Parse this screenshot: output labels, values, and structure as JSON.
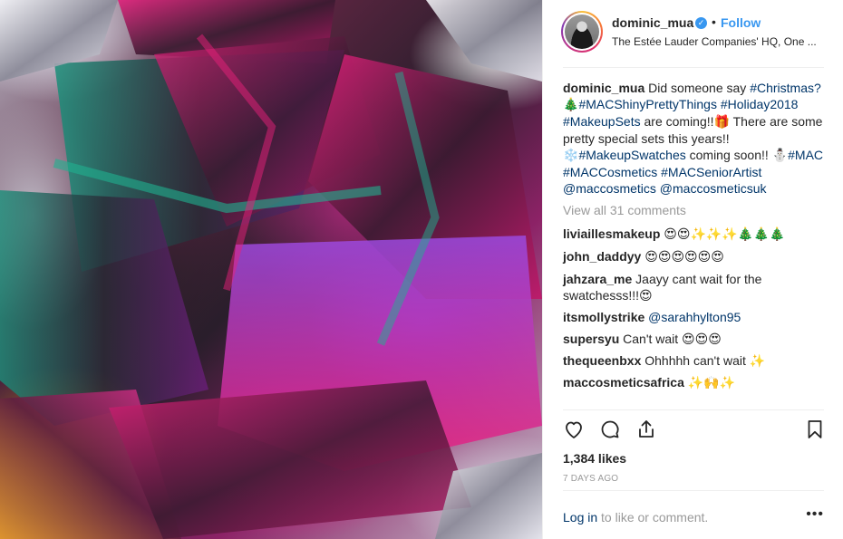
{
  "post": {
    "username": "dominic_mua",
    "verified_icon": "verified-badge-icon",
    "separator": "•",
    "follow_label": "Follow",
    "location": "The Estée Lauder Companies' HQ, One ..."
  },
  "caption": {
    "username": "dominic_mua",
    "text1": "Did someone say",
    "tag1": "#Christmas?",
    "emoji1": "🎄",
    "tag2": "#MACShinyPrettyThings",
    "tag3": "#Holiday2018",
    "tag4": "#MakeupSets",
    "text2": "are coming!!",
    "emoji2": "🎁",
    "text3": "There are some pretty special sets this years!!",
    "emoji3": "❄️",
    "tag5": "#MakeupSwatches",
    "text4": "coming soon!!",
    "emoji4": "⛄",
    "tag6": "#MAC",
    "tag7": "#MACCosmetics",
    "tag8": "#MACSeniorArtist",
    "tag9": "@maccosmetics",
    "tag10": "@maccosmeticsuk"
  },
  "view_all": "View all 31 comments",
  "comments": [
    {
      "user": "liviaillesmakeup",
      "text": "😍😍✨✨✨🎄🎄🎄"
    },
    {
      "user": "john_daddyy",
      "text": "😍😍😍😍😍😍"
    },
    {
      "user": "jahzara_me",
      "text": "Jaayy cant wait for the swatchesss!!!😍"
    },
    {
      "user": "itsmollystrike",
      "mention": "@sarahhylton95"
    },
    {
      "user": "supersyu",
      "text": "Can't wait 😍😍😍"
    },
    {
      "user": "thequeenbxx",
      "text": "Ohhhhh can't wait ✨"
    },
    {
      "user": "maccosmeticsafrica",
      "text": "✨🙌✨"
    }
  ],
  "actions": {
    "like_icon": "heart-icon",
    "comment_icon": "comment-icon",
    "share_icon": "share-icon",
    "save_icon": "bookmark-icon"
  },
  "likes": "1,384 likes",
  "date": "7 DAYS AGO",
  "login": {
    "link": "Log in",
    "text": "to like or comment."
  },
  "more": "•••"
}
